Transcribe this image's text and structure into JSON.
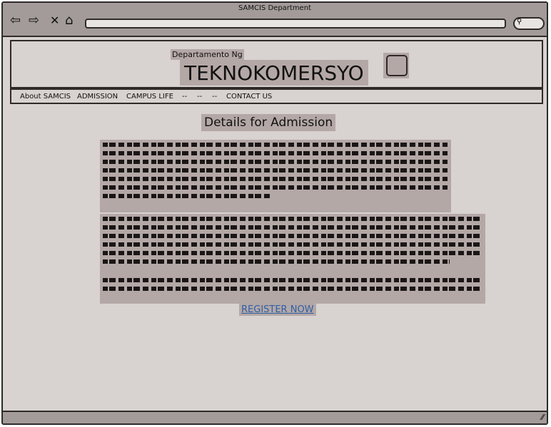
{
  "window": {
    "title": "SAMCIS Department"
  },
  "toolbar": {
    "back_icon": "⇦",
    "forward_icon": "⇨",
    "close_icon": "✕",
    "home_icon": "⌂",
    "search_icon": "⚲"
  },
  "header": {
    "subtitle": "Departamento Ng",
    "title": "TEKNOKOMERSYO"
  },
  "menu": {
    "items": [
      {
        "label": "About SAMCIS"
      },
      {
        "label": "ADMISSION"
      },
      {
        "label": "CAMPUS LIFE"
      },
      {
        "label": "--"
      },
      {
        "label": "--"
      },
      {
        "label": "--"
      },
      {
        "label": "CONTACT US"
      }
    ]
  },
  "content": {
    "title": "Details for Admission",
    "register_label": "REGISTER NOW"
  },
  "statusbar": {
    "resize_icon": "⁄⁄"
  }
}
